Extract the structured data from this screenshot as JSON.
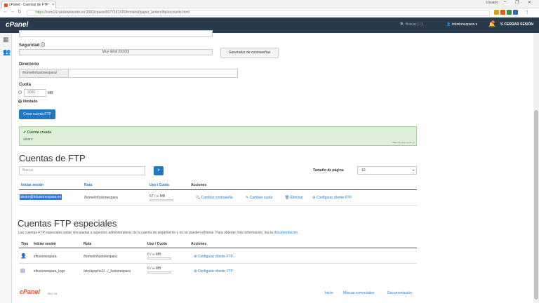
{
  "browser": {
    "tab_title": "cPanel - Cuentas de FTP",
    "tab_close": "×",
    "user": "Usuario",
    "min": "–",
    "max": "❐",
    "close": "✕",
    "url_https": "https://",
    "url_rest": "com14.raiolanetworks.es:2083/cpsess5577187476/frontend/paper_lantern/ftp/accounts.html"
  },
  "cpanel": {
    "logo": "cPanel",
    "search": "Buscar ( / )",
    "user": "infusionespara",
    "badge": "1",
    "logout": "CERRAR SESIÓN"
  },
  "form": {
    "security_label": "Seguridad",
    "strength": "Muy débil (0/100)",
    "generator": "Generador de contraseñas",
    "directory_label": "Directorio",
    "directory_prefix": "/home/infusionespara/",
    "quota_label": "Cuota",
    "quota_value": "2000",
    "quota_unit": "MB",
    "unlimited": "Ilimitado",
    "create_btn": "Crear cuenta FTP"
  },
  "alert": {
    "title": "Cuenta creada",
    "text": "alvaro",
    "small": "Haga clic para cerrar. 11"
  },
  "ftp": {
    "heading": "Cuentas de FTP",
    "search_placeholder": "Buscar",
    "go": "Ir",
    "page_size_label": "Tamaño de página",
    "page_size": "10",
    "headers": [
      "Iniciar sesión",
      "Ruta",
      "Uso / Cuota",
      "Acciones"
    ],
    "row": {
      "login": "alvaro@infusionespara.es",
      "path": "/home/infusionespara",
      "usage": "57 / ∞ MB",
      "actions": [
        "Cambiar contraseña",
        "Cambiar cuota",
        "Eliminar",
        "Configurar cliente FTP"
      ]
    }
  },
  "special": {
    "heading": "Cuentas FTP especiales",
    "desc": "Las cuentas FTP especiales están vinculadas a aspectos administrativos de la cuenta de alojamiento y no se pueden eliminar. Para obtener más información, lea la",
    "desc_link": "documentación",
    "headers": [
      "Tipo",
      "Iniciar sesión",
      "Ruta",
      "Uso / Cuota",
      "Acciones"
    ],
    "rows": [
      {
        "login": "infusionespara",
        "path": "/home/infusionespara",
        "usage": "0 / ∞ MB",
        "action": "Configurar cliente FTP"
      },
      {
        "login": "infusionespara_logs",
        "path": "/etc/apache2/.../_fusionespara",
        "usage": "0 / ∞ MB",
        "action": "Configurar cliente FTP"
      }
    ]
  },
  "footer": {
    "logo": "cPanel",
    "version": "68.0.28",
    "links": [
      "Inicio",
      "Marcas comerciales",
      "Documentación"
    ]
  }
}
